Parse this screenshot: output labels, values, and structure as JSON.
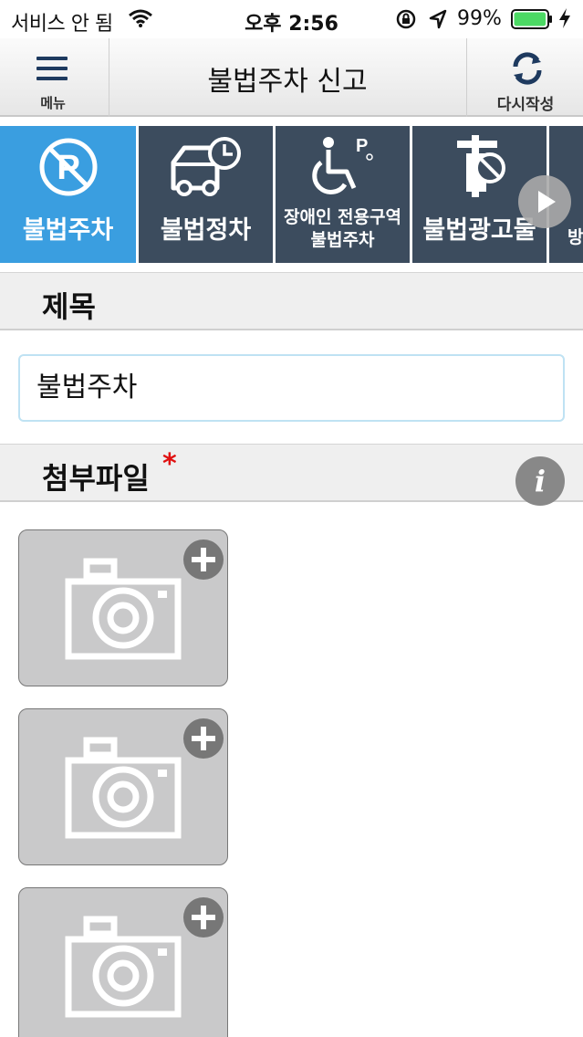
{
  "status_bar": {
    "carrier": "서비스 안 됨",
    "time": "오후 2:56",
    "battery_percent": "99%",
    "battery_level": 0.99,
    "battery_color": "#4cd964"
  },
  "navbar": {
    "menu_label": "메뉴",
    "title": "불법주차 신고",
    "rewrite_label": "다시작성"
  },
  "categories": [
    {
      "label": "불법주차",
      "icon": "no-parking-icon",
      "active": true
    },
    {
      "label": "불법정차",
      "icon": "truck-clock-icon",
      "active": false
    },
    {
      "label_line1": "장애인 전용구역",
      "label_line2": "불법주차",
      "icon": "wheelchair-parking-icon",
      "active": false
    },
    {
      "label": "불법광고물",
      "icon": "illegal-ad-icon",
      "active": false
    },
    {
      "label": "방",
      "icon": "partial-icon",
      "active": false
    }
  ],
  "colors": {
    "active_tab": "#3a9ee0",
    "inactive_tab": "#3c4c5e",
    "required_mark": "#e01010"
  },
  "subject": {
    "heading": "제목",
    "value": "불법주차"
  },
  "attachments": {
    "heading": "첨부파일",
    "required_mark": "*",
    "info_symbol": "i",
    "slots": [
      "camera-icon",
      "camera-icon",
      "camera-icon"
    ]
  }
}
